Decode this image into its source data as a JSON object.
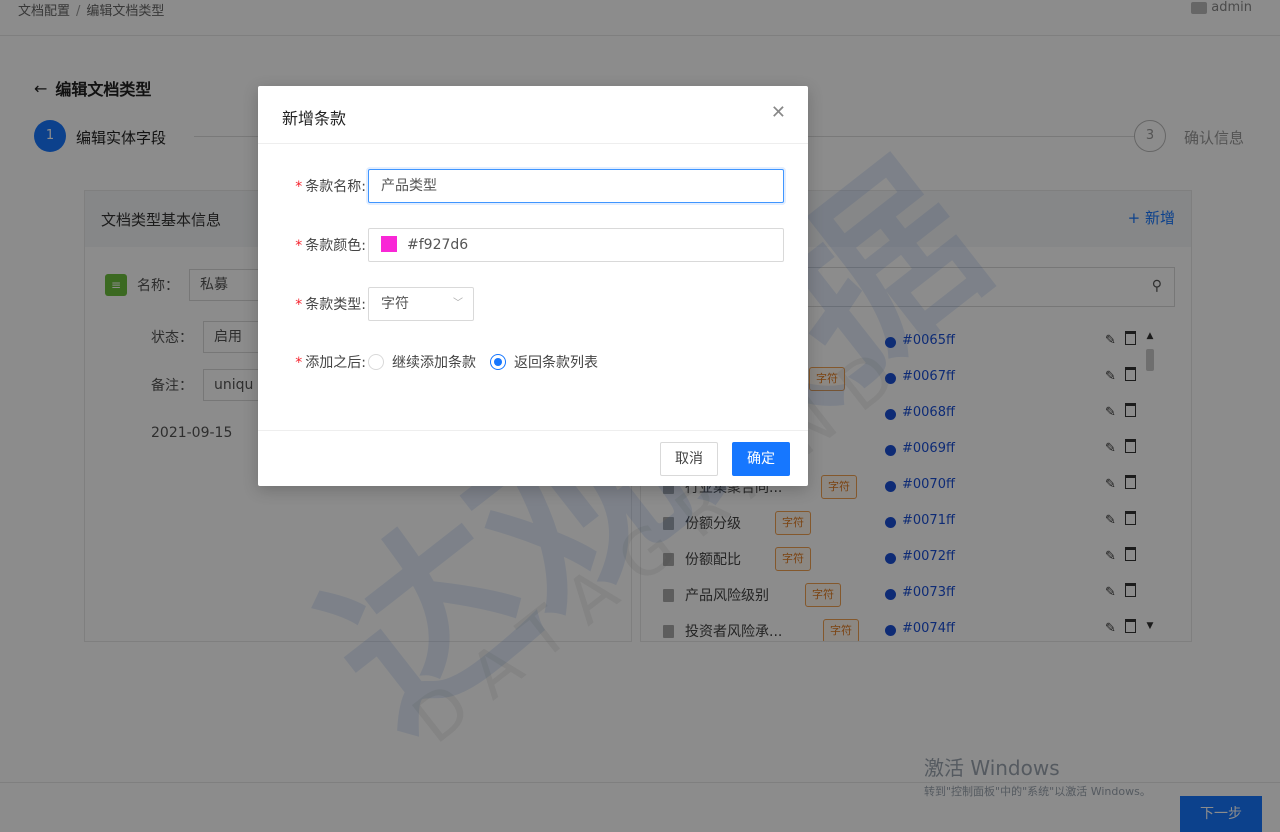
{
  "breadcrumb": {
    "root": "文档配置",
    "sep": "/",
    "current": "编辑文档类型"
  },
  "user": {
    "name": "admin"
  },
  "page": {
    "title": "编辑文档类型",
    "back_icon": "arrow-left-icon"
  },
  "steps": {
    "step1": {
      "num": "1",
      "label": "编辑实体字段"
    },
    "step3": {
      "num": "3",
      "label": "确认信息"
    }
  },
  "basic_info": {
    "title": "文档类型基本信息",
    "name_label": "名称：",
    "name_value": "私募",
    "status_label": "状态：",
    "status_value": "启用",
    "note_label": "备注：",
    "note_value": "uniqu",
    "date": "2021-09-15"
  },
  "clause_panel": {
    "add_label": "新增",
    "rows": [
      {
        "name": "",
        "tag": "",
        "color": "#0065ff"
      },
      {
        "name": "",
        "tag": "字符",
        "color": "#0067ff"
      },
      {
        "name": "",
        "tag": "",
        "color": "#0068ff"
      },
      {
        "name": "",
        "tag": "",
        "color": "#0069ff"
      },
      {
        "name": "行业集聚合同...",
        "tag": "字符",
        "color": "#0070ff"
      },
      {
        "name": "份额分级",
        "tag": "字符",
        "color": "#0071ff"
      },
      {
        "name": "份额配比",
        "tag": "字符",
        "color": "#0072ff"
      },
      {
        "name": "产品风险级别",
        "tag": "字符",
        "color": "#0073ff"
      },
      {
        "name": "投资者风险承...",
        "tag": "字符",
        "color": "#0074ff"
      }
    ]
  },
  "footer": {
    "next_label": "下一步"
  },
  "windows_activation": {
    "line1": "激活 Windows",
    "line2": "转到\"控制面板\"中的\"系统\"以激活 Windows。"
  },
  "watermark": {
    "text": "达观数据",
    "sub": "DATAGRAND"
  },
  "modal": {
    "title": "新增条款",
    "close_icon": "close-icon",
    "name_label": "条款名称:",
    "name_value": "产品类型",
    "color_label": "条款颜色:",
    "color_value": "#f927d6",
    "type_label": "条款类型:",
    "type_value": "字符",
    "after_label": "添加之后:",
    "after_options": [
      "继续添加条款",
      "返回条款列表"
    ],
    "after_selected": 1,
    "cancel_label": "取消",
    "ok_label": "确定"
  },
  "colors": {
    "accent": "#1677ff",
    "swatch": "#f927d6",
    "tag": "#e07a20"
  }
}
